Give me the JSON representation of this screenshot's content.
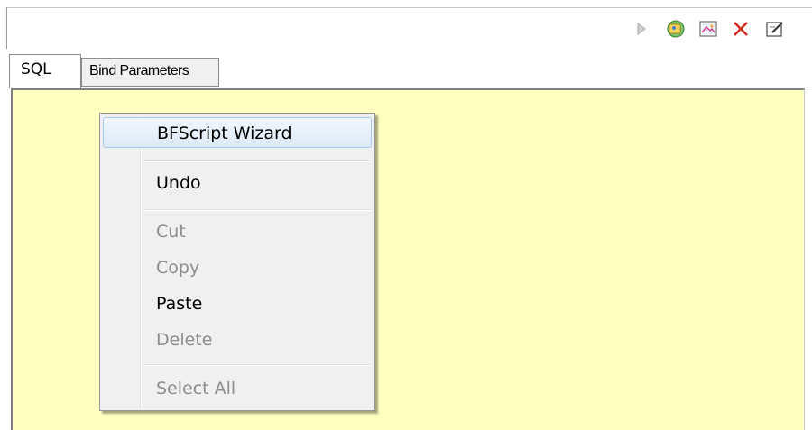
{
  "toolbar": {
    "buttons": [
      {
        "icon": "run-icon"
      },
      {
        "icon": "explain-plan-icon"
      },
      {
        "icon": "image-icon"
      },
      {
        "icon": "close-icon"
      },
      {
        "icon": "edit-icon"
      }
    ]
  },
  "tabs": [
    {
      "label": "SQL",
      "active": true
    },
    {
      "label": "Bind Parameters",
      "active": false
    }
  ],
  "editor": {
    "background": "#ffffc0"
  },
  "context_menu": {
    "items": [
      {
        "label": "BFScript Wizard",
        "enabled": true,
        "highlighted": true
      },
      {
        "label": "Undo",
        "enabled": true
      },
      {
        "label": "Cut",
        "enabled": false
      },
      {
        "label": "Copy",
        "enabled": false
      },
      {
        "label": "Paste",
        "enabled": true
      },
      {
        "label": "Delete",
        "enabled": false
      },
      {
        "label": "Select All",
        "enabled": false
      }
    ]
  }
}
